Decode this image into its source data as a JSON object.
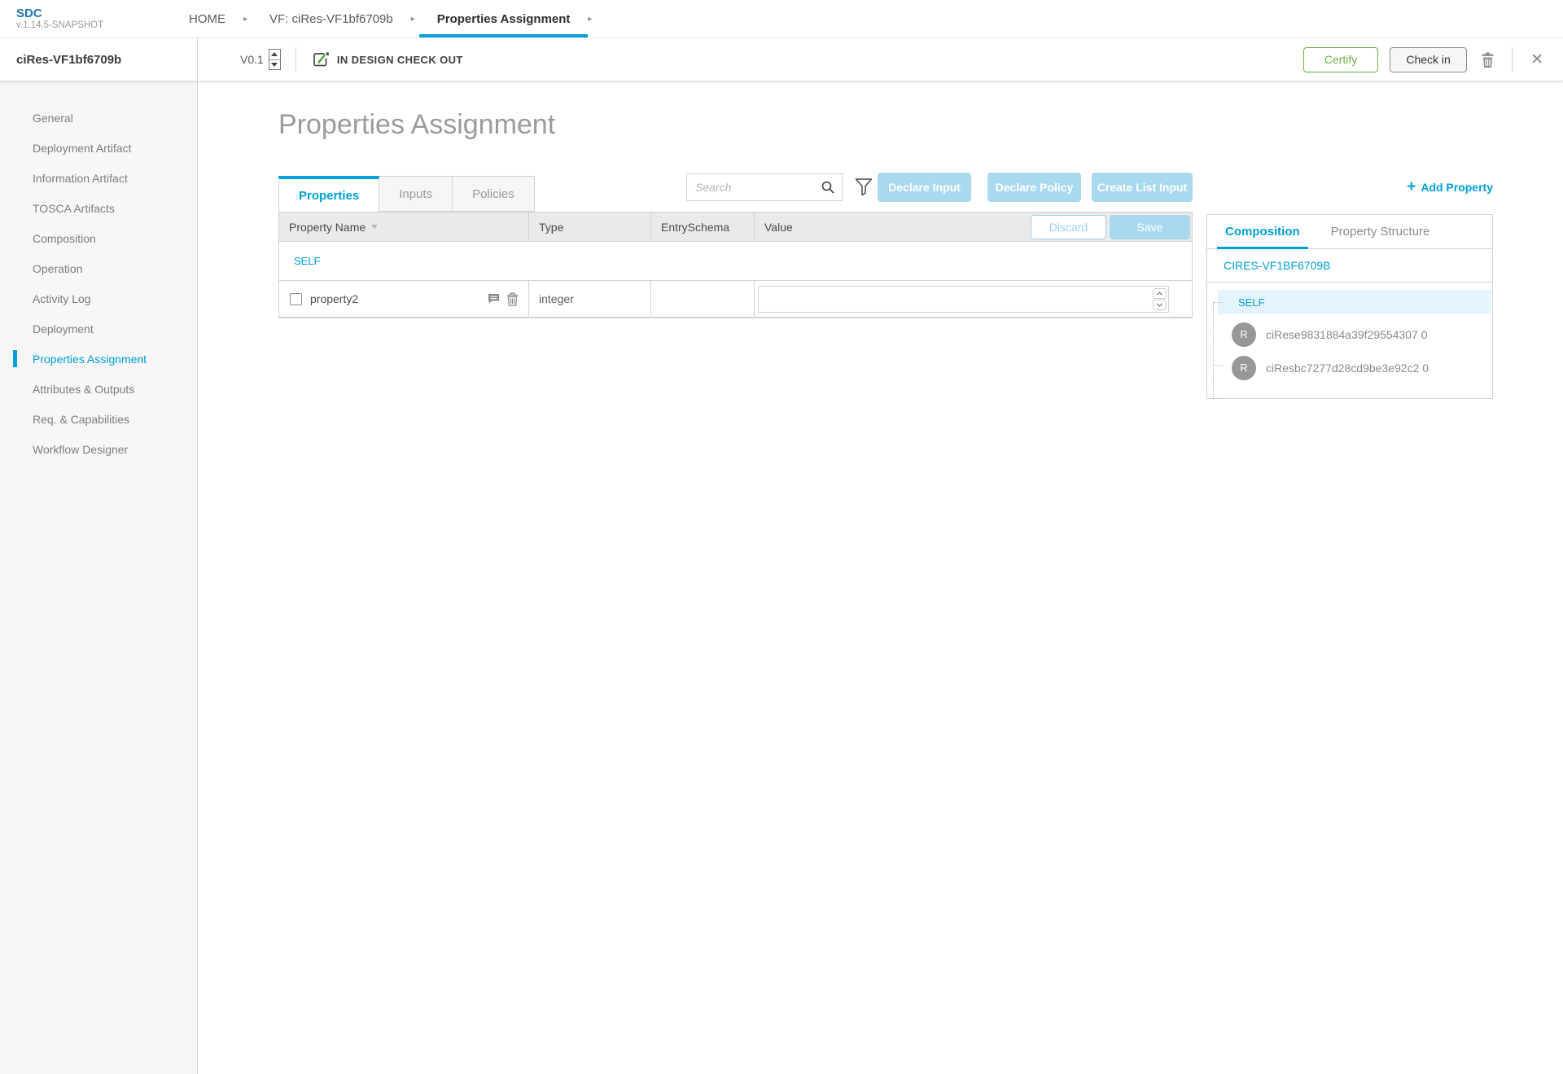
{
  "app": {
    "name": "SDC",
    "version": "v.1.14.5-SNAPSHOT"
  },
  "breadcrumb": {
    "items": [
      {
        "label": "HOME"
      },
      {
        "label": "VF: ciRes-VF1bf6709b"
      },
      {
        "label": "Properties Assignment"
      }
    ]
  },
  "header": {
    "component_name": "ciRes-VF1bf6709b",
    "version": "V0.1",
    "state": "IN DESIGN CHECK OUT",
    "certify_label": "Certify",
    "checkin_label": "Check in"
  },
  "sidebar": {
    "items": [
      {
        "label": "General"
      },
      {
        "label": "Deployment Artifact"
      },
      {
        "label": "Information Artifact"
      },
      {
        "label": "TOSCA Artifacts"
      },
      {
        "label": "Composition"
      },
      {
        "label": "Operation"
      },
      {
        "label": "Activity Log"
      },
      {
        "label": "Deployment"
      },
      {
        "label": "Properties Assignment"
      },
      {
        "label": "Attributes & Outputs"
      },
      {
        "label": "Req. & Capabilities"
      },
      {
        "label": "Workflow Designer"
      }
    ]
  },
  "main": {
    "title": "Properties Assignment",
    "tabs": [
      {
        "label": "Properties"
      },
      {
        "label": "Inputs"
      },
      {
        "label": "Policies"
      }
    ],
    "search": {
      "placeholder": "Search"
    },
    "toolbar": {
      "declare_input_label": "Declare Input",
      "declare_policy_label": "Declare Policy",
      "create_list_input_label": "Create List Input",
      "add_property_plus": "+",
      "add_property_label": "Add Property"
    },
    "table": {
      "columns": [
        "Property Name",
        "Type",
        "EntrySchema",
        "Value"
      ],
      "discard_label": "Discard",
      "save_label": "Save",
      "group_label": "SELF",
      "rows": [
        {
          "name": "property2",
          "type": "integer",
          "entry_schema": "",
          "value": ""
        }
      ]
    }
  },
  "right_panel": {
    "tabs": [
      {
        "label": "Composition"
      },
      {
        "label": "Property Structure"
      }
    ],
    "component_title": "CIRES-VF1BF6709B",
    "tree": {
      "self_label": "SELF",
      "instances": [
        {
          "badge": "R",
          "label": "ciRese9831884a39f29554307 0"
        },
        {
          "badge": "R",
          "label": "ciResbc7277d28cd9be3e92c2 0"
        }
      ]
    }
  },
  "colors": {
    "accent": "#009fdb",
    "certify_green": "#67b342",
    "button_light_blue": "#a9d9ee"
  }
}
